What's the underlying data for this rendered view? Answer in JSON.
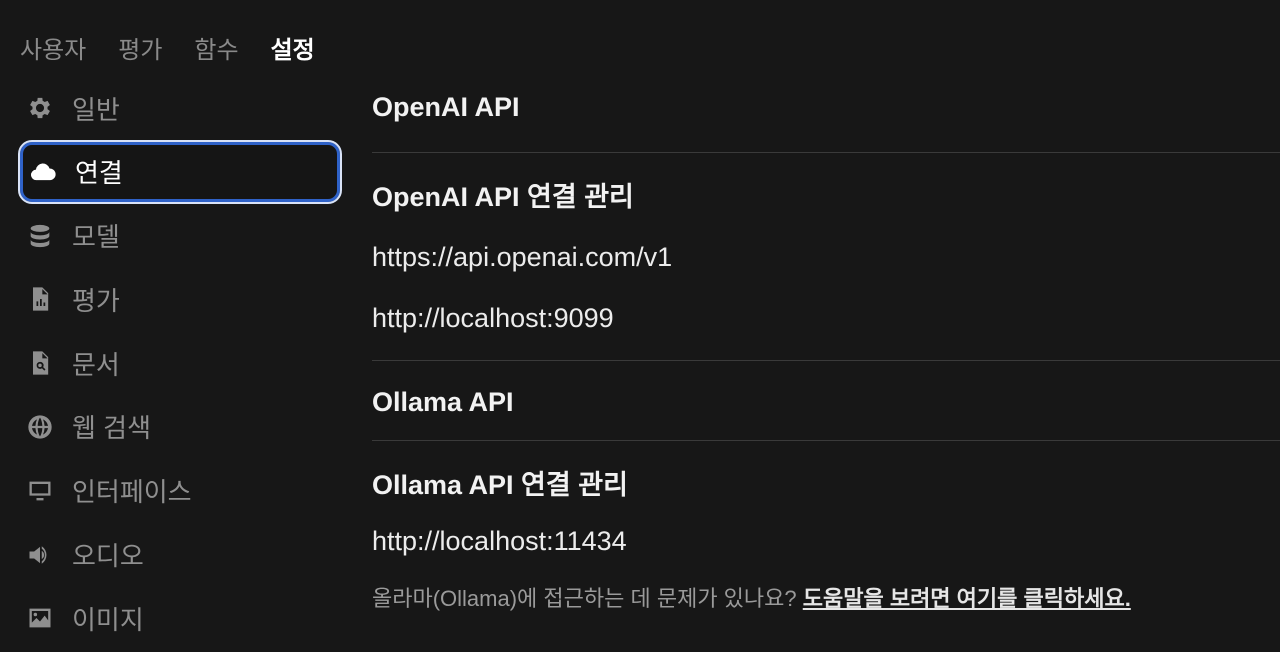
{
  "top_tabs": [
    {
      "label": "사용자",
      "active": false
    },
    {
      "label": "평가",
      "active": false
    },
    {
      "label": "함수",
      "active": false
    },
    {
      "label": "설정",
      "active": true
    }
  ],
  "sidebar": {
    "items": [
      {
        "label": "일반",
        "icon": "gear-icon"
      },
      {
        "label": "연결",
        "icon": "cloud-icon",
        "active": true
      },
      {
        "label": "모델",
        "icon": "database-icon"
      },
      {
        "label": "평가",
        "icon": "document-chart-icon"
      },
      {
        "label": "문서",
        "icon": "document-search-icon"
      },
      {
        "label": "웹 검색",
        "icon": "globe-icon"
      },
      {
        "label": "인터페이스",
        "icon": "monitor-icon"
      },
      {
        "label": "오디오",
        "icon": "speaker-icon"
      },
      {
        "label": "이미지",
        "icon": "image-icon"
      }
    ]
  },
  "main": {
    "openai_title": "OpenAI API",
    "openai_manage_title": "OpenAI API 연결 관리",
    "openai_urls": [
      "https://api.openai.com/v1",
      "http://localhost:9099"
    ],
    "ollama_title": "Ollama API",
    "ollama_manage_title": "Ollama API 연결 관리",
    "ollama_urls": [
      "http://localhost:11434"
    ],
    "help_text": "올라마(Ollama)에 접근하는 데 문제가 있나요? ",
    "help_link": "도움말을 보려면 여기를 클릭하세요."
  },
  "colors": {
    "background": "#171717",
    "active_border": "#2f62c8",
    "muted_text": "#8f8f8f"
  }
}
